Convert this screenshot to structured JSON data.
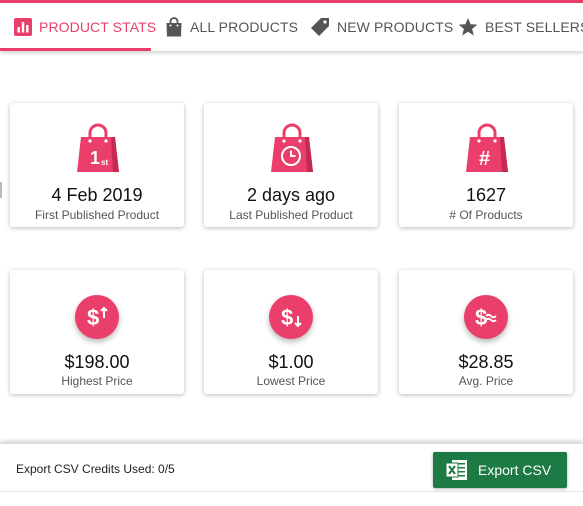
{
  "tabs": [
    {
      "label": "PRODUCT STATS",
      "icon": "bar-chart-icon",
      "active": true
    },
    {
      "label": "ALL PRODUCTS",
      "icon": "shopping-bag-icon",
      "active": false
    },
    {
      "label": "NEW PRODUCTS",
      "icon": "tag-icon",
      "active": false
    },
    {
      "label": "BEST SELLERS",
      "icon": "star-icon",
      "active": false
    }
  ],
  "stats": {
    "first_published": {
      "value": "4 Feb 2019",
      "label": "First Published Product",
      "icon": "bag-first-icon",
      "icon_text": "1",
      "icon_sub": "st"
    },
    "last_published": {
      "value": "2 days ago",
      "label": "Last Published Product",
      "icon": "bag-clock-icon"
    },
    "num_products": {
      "value": "1627",
      "label": "# Of Products",
      "icon": "bag-hash-icon",
      "icon_text": "#"
    },
    "highest_price": {
      "value": "$198.00",
      "label": "Highest Price",
      "icon": "dollar-up-icon"
    },
    "lowest_price": {
      "value": "$1.00",
      "label": "Lowest Price",
      "icon": "dollar-down-icon"
    },
    "avg_price": {
      "value": "$28.85",
      "label": "Avg. Price",
      "icon": "dollar-approx-icon"
    }
  },
  "footer": {
    "credits_text": "Export CSV Credits Used: 0/5",
    "export_label": "Export CSV",
    "export_icon": "excel-icon"
  },
  "colors": {
    "accent": "#ea3f6b",
    "export_green": "#1e7a45"
  }
}
